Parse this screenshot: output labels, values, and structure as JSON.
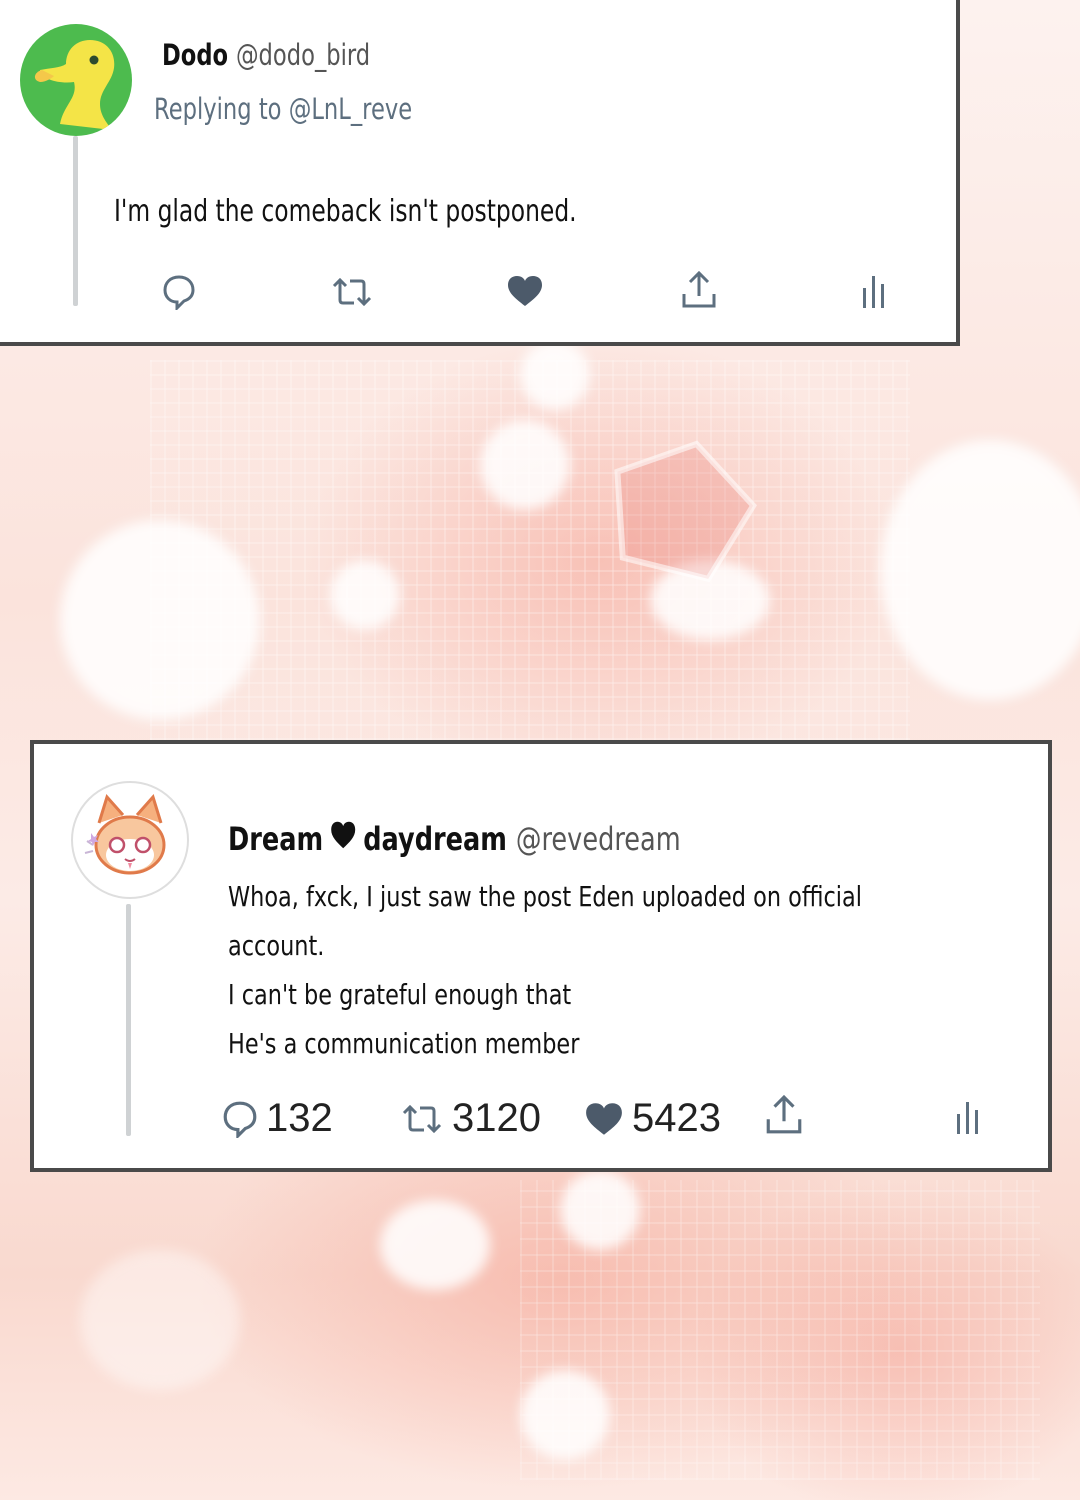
{
  "tweet_reply": {
    "display_name": "Dodo",
    "handle": "@dodo_bird",
    "replying_to": "Replying to @LnL_reve",
    "text": "I'm glad the comeback isn't postponed.",
    "avatar_icon": "duck-avatar-icon",
    "actions": [
      "reply-icon",
      "retweet-icon",
      "like-icon",
      "share-icon",
      "analytics-icon"
    ]
  },
  "tweet_main": {
    "display_name_first": "Dream",
    "display_name_second": "daydream",
    "handle": "@revedream",
    "text_lines": [
      "Whoa, fxck, I just saw the post Eden uploaded on official",
      "account.",
      "I can't be grateful enough that",
      "He's a communication member"
    ],
    "avatar_icon": "cat-avatar-icon",
    "reply_count": "132",
    "retweet_count": "3120",
    "like_count": "5423"
  },
  "colors": {
    "card_border": "#4a4a4a",
    "icon_gray": "#5d6f7f",
    "like_dark": "#4c5a6a",
    "duck_green": "#4dbb4e",
    "duck_yellow": "#f4e447"
  }
}
